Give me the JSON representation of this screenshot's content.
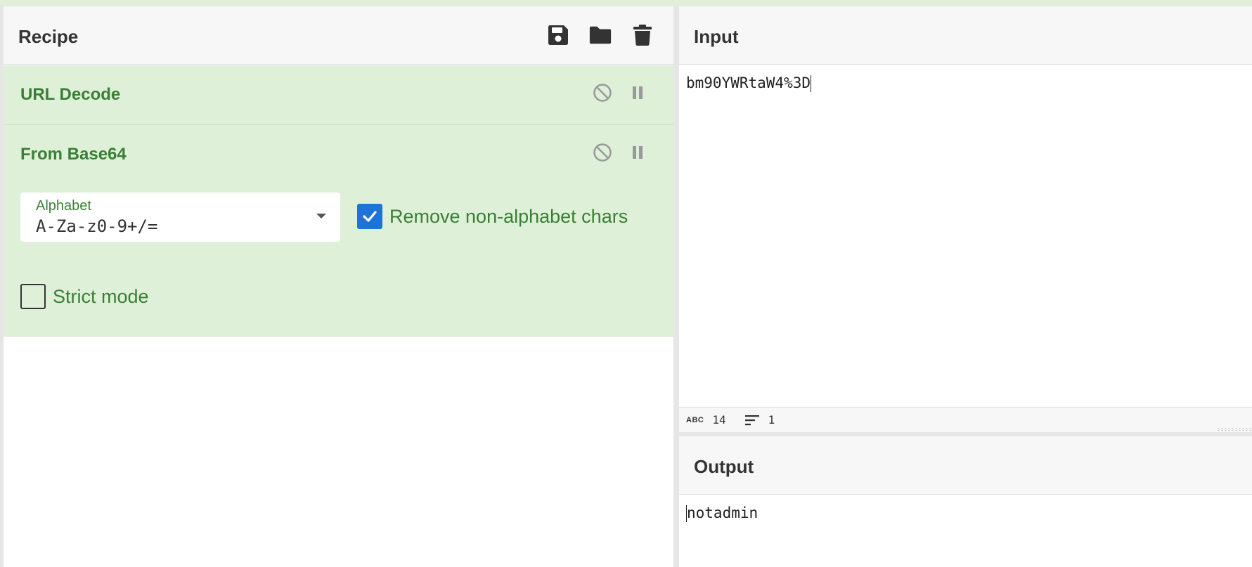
{
  "colors": {
    "op_background": "#dff0d8",
    "op_text": "#3a7f36",
    "checkbox_checked": "#1e73d8",
    "header_background": "#f7f7f7"
  },
  "recipe": {
    "title": "Recipe",
    "icons": [
      "save-icon",
      "folder-icon",
      "trash-icon"
    ],
    "operations": [
      {
        "name": "URL Decode",
        "controls": [
          "disable-icon",
          "pause-icon"
        ]
      },
      {
        "name": "From Base64",
        "controls": [
          "disable-icon",
          "pause-icon"
        ],
        "alphabet": {
          "label": "Alphabet",
          "value": "A-Za-z0-9+/="
        },
        "remove_non_alphabet": {
          "label": "Remove non-alphabet chars",
          "checked": true
        },
        "strict_mode": {
          "label": "Strict mode",
          "checked": false
        }
      }
    ]
  },
  "input": {
    "title": "Input",
    "text": "bm90YWRtaW4%3D",
    "status": {
      "chars_icon": "ABC",
      "chars": "14",
      "lines_icon": "lines-icon",
      "lines": "1"
    }
  },
  "output": {
    "title": "Output",
    "text": "notadmin"
  }
}
